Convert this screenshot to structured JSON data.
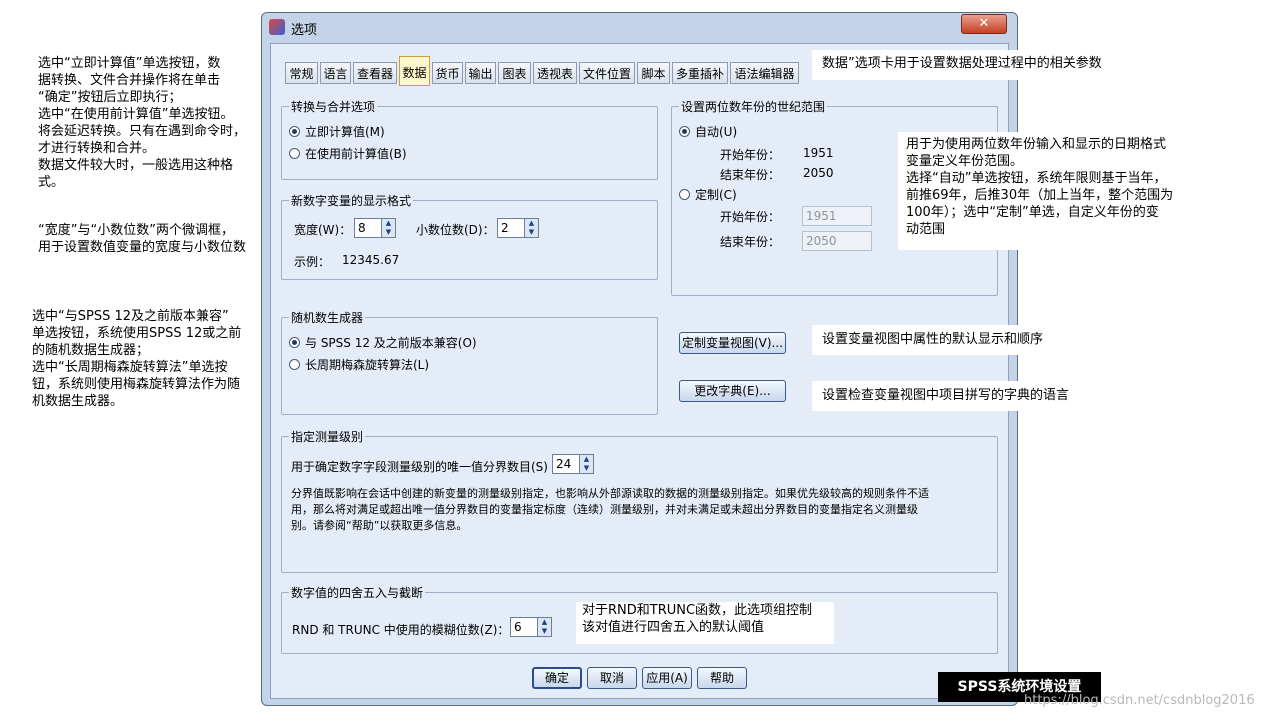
{
  "window": {
    "title": "选项",
    "close_symbol": "✕"
  },
  "tabs": [
    "常规",
    "语言",
    "查看器",
    "数据",
    "货币",
    "输出",
    "图表",
    "透视表",
    "文件位置",
    "脚本",
    "多重插补",
    "语法编辑器"
  ],
  "conversion": {
    "title": "转换与合并选项",
    "opt_immediate": "立即计算值(M)",
    "opt_before_use": "在使用前计算值(B)"
  },
  "numeric_format": {
    "title": "新数字变量的显示格式",
    "width_label": "宽度(W)：",
    "width_value": "8",
    "decimals_label": "小数位数(D)：",
    "decimals_value": "2",
    "example_label": "示例：",
    "example_value": "12345.67"
  },
  "century": {
    "title": "设置两位数年份的世纪范围",
    "opt_auto": "自动(U)",
    "start_label": "开始年份：",
    "start_value": "1951",
    "end_label": "结束年份：",
    "end_value": "2050",
    "opt_custom": "定制(C)",
    "custom_start_label": "开始年份：",
    "custom_start_value": "1951",
    "custom_end_label": "结束年份：",
    "custom_end_value": "2050"
  },
  "random": {
    "title": "随机数生成器",
    "opt_compat": "与 SPSS 12 及之前版本兼容(O)",
    "opt_mersenne": "长周期梅森旋转算法(L)"
  },
  "buttons": {
    "custom_view": "定制变量视图(V)...",
    "change_dict": "更改字典(E)...",
    "ok": "确定",
    "cancel": "取消",
    "apply": "应用(A)",
    "help": "帮助"
  },
  "measurement": {
    "title": "指定测量级别",
    "label": "用于确定数字字段测量级别的唯一值分界数目(S)",
    "value": "24",
    "desc_line1": "分界值既影响在会话中创建的新变量的测量级别指定，也影响从外部源读取的数据的测量级别指定。如果优先级较高的规则条件不适",
    "desc_line2": "用，那么将对满足或超出唯一值分界数目的变量指定标度（连续）测量级别，并对未满足或未超出分界数目的变量指定名义测量级",
    "desc_line3": "别。请参阅“帮助”以获取更多信息。"
  },
  "rounding": {
    "title": "数字值的四舍五入与截断",
    "label": "RND 和 TRUNC 中使用的模糊位数(Z)：",
    "value": "6"
  },
  "annotations": {
    "left_top": "选中“立即计算值”单选按钮，数\n据转换、文件合并操作将在单击\n“确定”按钮后立即执行；\n选中“在使用前计算值”单选按钮。\n将会延迟转换。只有在遇到命令时，\n才进行转换和合并。\n数据文件较大时，一般选用这种格\n式。",
    "left_mid": "“宽度”与“小数位数”两个微调框，\n用于设置数值变量的宽度与小数位数",
    "left_bottom": "选中“与SPSS 12及之前版本兼容”\n单选按钮，系统使用SPSS 12或之前\n的随机数据生成器；\n选中“长周期梅森旋转算法”单选按\n钮，系统则使用梅森旋转算法作为随\n机数据生成器。",
    "right_tab": "数据”选项卡用于设置数据处理过程中的相关参数",
    "right_century": "用于为使用两位数年份输入和显示的日期格式\n变量定义年份范围。\n选择“自动”单选按钮，系统年限则基于当年，\n前推69年，后推30年（加上当年，整个范围为\n100年）；选中“定制”单选，自定义年份的变\n动范围",
    "right_view": "设置变量视图中属性的默认显示和顺序",
    "right_dict": "设置检查变量视图中项目拼写的字典的语言",
    "rounding_note": "对于RND和TRUNC函数，此选项组控制\n该对值进行四舍五入的默认阈值"
  },
  "footer": {
    "badge": "SPSS系统环境设置",
    "watermark": "https://blog.csdn.net/csdnblog2016"
  }
}
